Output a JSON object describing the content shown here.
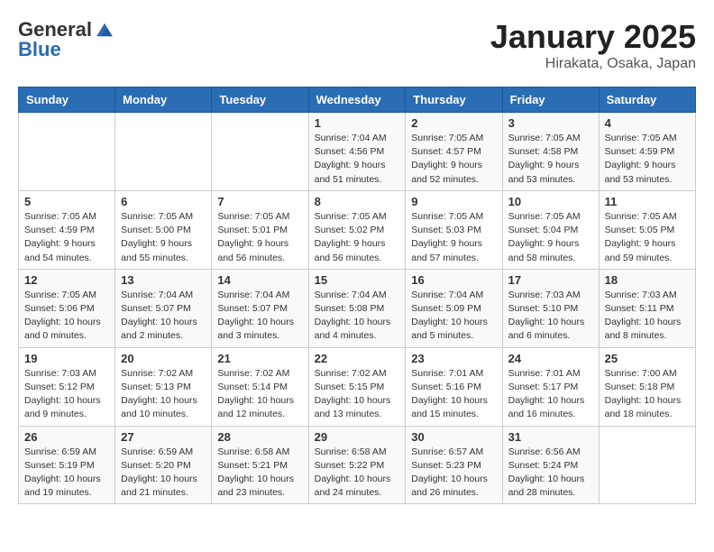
{
  "header": {
    "logo_general": "General",
    "logo_blue": "Blue",
    "title": "January 2025",
    "subtitle": "Hirakata, Osaka, Japan"
  },
  "days_of_week": [
    "Sunday",
    "Monday",
    "Tuesday",
    "Wednesday",
    "Thursday",
    "Friday",
    "Saturday"
  ],
  "weeks": [
    [
      {
        "day": "",
        "detail": ""
      },
      {
        "day": "",
        "detail": ""
      },
      {
        "day": "",
        "detail": ""
      },
      {
        "day": "1",
        "detail": "Sunrise: 7:04 AM\nSunset: 4:56 PM\nDaylight: 9 hours\nand 51 minutes."
      },
      {
        "day": "2",
        "detail": "Sunrise: 7:05 AM\nSunset: 4:57 PM\nDaylight: 9 hours\nand 52 minutes."
      },
      {
        "day": "3",
        "detail": "Sunrise: 7:05 AM\nSunset: 4:58 PM\nDaylight: 9 hours\nand 53 minutes."
      },
      {
        "day": "4",
        "detail": "Sunrise: 7:05 AM\nSunset: 4:59 PM\nDaylight: 9 hours\nand 53 minutes."
      }
    ],
    [
      {
        "day": "5",
        "detail": "Sunrise: 7:05 AM\nSunset: 4:59 PM\nDaylight: 9 hours\nand 54 minutes."
      },
      {
        "day": "6",
        "detail": "Sunrise: 7:05 AM\nSunset: 5:00 PM\nDaylight: 9 hours\nand 55 minutes."
      },
      {
        "day": "7",
        "detail": "Sunrise: 7:05 AM\nSunset: 5:01 PM\nDaylight: 9 hours\nand 56 minutes."
      },
      {
        "day": "8",
        "detail": "Sunrise: 7:05 AM\nSunset: 5:02 PM\nDaylight: 9 hours\nand 56 minutes."
      },
      {
        "day": "9",
        "detail": "Sunrise: 7:05 AM\nSunset: 5:03 PM\nDaylight: 9 hours\nand 57 minutes."
      },
      {
        "day": "10",
        "detail": "Sunrise: 7:05 AM\nSunset: 5:04 PM\nDaylight: 9 hours\nand 58 minutes."
      },
      {
        "day": "11",
        "detail": "Sunrise: 7:05 AM\nSunset: 5:05 PM\nDaylight: 9 hours\nand 59 minutes."
      }
    ],
    [
      {
        "day": "12",
        "detail": "Sunrise: 7:05 AM\nSunset: 5:06 PM\nDaylight: 10 hours\nand 0 minutes."
      },
      {
        "day": "13",
        "detail": "Sunrise: 7:04 AM\nSunset: 5:07 PM\nDaylight: 10 hours\nand 2 minutes."
      },
      {
        "day": "14",
        "detail": "Sunrise: 7:04 AM\nSunset: 5:07 PM\nDaylight: 10 hours\nand 3 minutes."
      },
      {
        "day": "15",
        "detail": "Sunrise: 7:04 AM\nSunset: 5:08 PM\nDaylight: 10 hours\nand 4 minutes."
      },
      {
        "day": "16",
        "detail": "Sunrise: 7:04 AM\nSunset: 5:09 PM\nDaylight: 10 hours\nand 5 minutes."
      },
      {
        "day": "17",
        "detail": "Sunrise: 7:03 AM\nSunset: 5:10 PM\nDaylight: 10 hours\nand 6 minutes."
      },
      {
        "day": "18",
        "detail": "Sunrise: 7:03 AM\nSunset: 5:11 PM\nDaylight: 10 hours\nand 8 minutes."
      }
    ],
    [
      {
        "day": "19",
        "detail": "Sunrise: 7:03 AM\nSunset: 5:12 PM\nDaylight: 10 hours\nand 9 minutes."
      },
      {
        "day": "20",
        "detail": "Sunrise: 7:02 AM\nSunset: 5:13 PM\nDaylight: 10 hours\nand 10 minutes."
      },
      {
        "day": "21",
        "detail": "Sunrise: 7:02 AM\nSunset: 5:14 PM\nDaylight: 10 hours\nand 12 minutes."
      },
      {
        "day": "22",
        "detail": "Sunrise: 7:02 AM\nSunset: 5:15 PM\nDaylight: 10 hours\nand 13 minutes."
      },
      {
        "day": "23",
        "detail": "Sunrise: 7:01 AM\nSunset: 5:16 PM\nDaylight: 10 hours\nand 15 minutes."
      },
      {
        "day": "24",
        "detail": "Sunrise: 7:01 AM\nSunset: 5:17 PM\nDaylight: 10 hours\nand 16 minutes."
      },
      {
        "day": "25",
        "detail": "Sunrise: 7:00 AM\nSunset: 5:18 PM\nDaylight: 10 hours\nand 18 minutes."
      }
    ],
    [
      {
        "day": "26",
        "detail": "Sunrise: 6:59 AM\nSunset: 5:19 PM\nDaylight: 10 hours\nand 19 minutes."
      },
      {
        "day": "27",
        "detail": "Sunrise: 6:59 AM\nSunset: 5:20 PM\nDaylight: 10 hours\nand 21 minutes."
      },
      {
        "day": "28",
        "detail": "Sunrise: 6:58 AM\nSunset: 5:21 PM\nDaylight: 10 hours\nand 23 minutes."
      },
      {
        "day": "29",
        "detail": "Sunrise: 6:58 AM\nSunset: 5:22 PM\nDaylight: 10 hours\nand 24 minutes."
      },
      {
        "day": "30",
        "detail": "Sunrise: 6:57 AM\nSunset: 5:23 PM\nDaylight: 10 hours\nand 26 minutes."
      },
      {
        "day": "31",
        "detail": "Sunrise: 6:56 AM\nSunset: 5:24 PM\nDaylight: 10 hours\nand 28 minutes."
      },
      {
        "day": "",
        "detail": ""
      }
    ]
  ]
}
